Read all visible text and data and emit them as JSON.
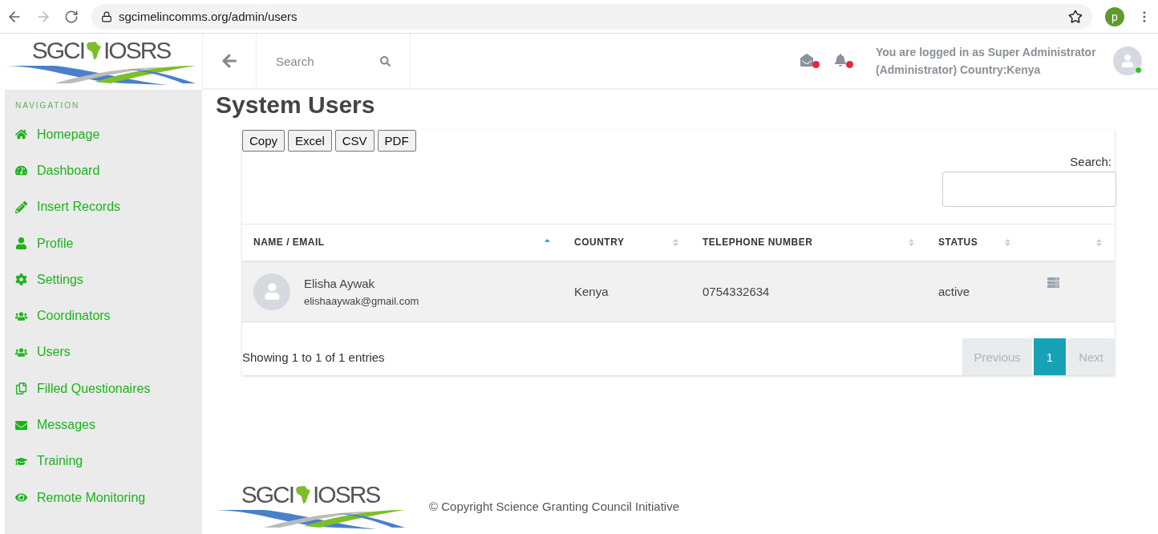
{
  "browser": {
    "url": "sgcimelincomms.org/admin/users",
    "profile_initial": "p"
  },
  "logo": {
    "left": "SGCI",
    "right": "IOSRS"
  },
  "header": {
    "search_placeholder": "Search",
    "notifications": [
      {
        "kind": "mail",
        "unread": true
      },
      {
        "kind": "bell",
        "unread": true
      }
    ],
    "login_text": "You are logged in as Super Administrator (Administrator) Country:Kenya",
    "online": true
  },
  "sidebar": {
    "heading": "NAVIGATION",
    "items": [
      {
        "label": "Homepage"
      },
      {
        "label": "Dashboard"
      },
      {
        "label": "Insert Records"
      },
      {
        "label": "Profile"
      },
      {
        "label": "Settings"
      },
      {
        "label": "Coordinators"
      },
      {
        "label": "Users"
      },
      {
        "label": "Filled Questionaires"
      },
      {
        "label": "Messages"
      },
      {
        "label": "Training"
      },
      {
        "label": "Remote Monitoring"
      }
    ]
  },
  "page_title": "System Users",
  "export_buttons": [
    "Copy",
    "Excel",
    "CSV",
    "PDF"
  ],
  "search_label": "Search:",
  "table": {
    "columns": [
      {
        "label": "NAME / EMAIL",
        "sorted": true
      },
      {
        "label": "COUNTRY",
        "sorted": false
      },
      {
        "label": "TELEPHONE NUMBER",
        "sorted": false
      },
      {
        "label": "STATUS",
        "sorted": false
      },
      {
        "sorted": false
      }
    ],
    "rows": [
      {
        "name": "Elisha Aywak",
        "email": "elishaaywak@gmail.com",
        "country": "Kenya",
        "phone": "0754332634",
        "status": "active"
      }
    ]
  },
  "info": "Showing 1 to 1 of 1 entries",
  "pagination": {
    "previous": {
      "label": "Previous",
      "disabled": true
    },
    "pages": [
      {
        "label": "1",
        "selected": true
      }
    ],
    "next": {
      "label": "Next",
      "disabled": true
    }
  },
  "footer": {
    "logo": {
      "left": "SGCI",
      "right": "IOSRS"
    },
    "copyright": "© Copyright Science Granting Council Initiative"
  }
}
